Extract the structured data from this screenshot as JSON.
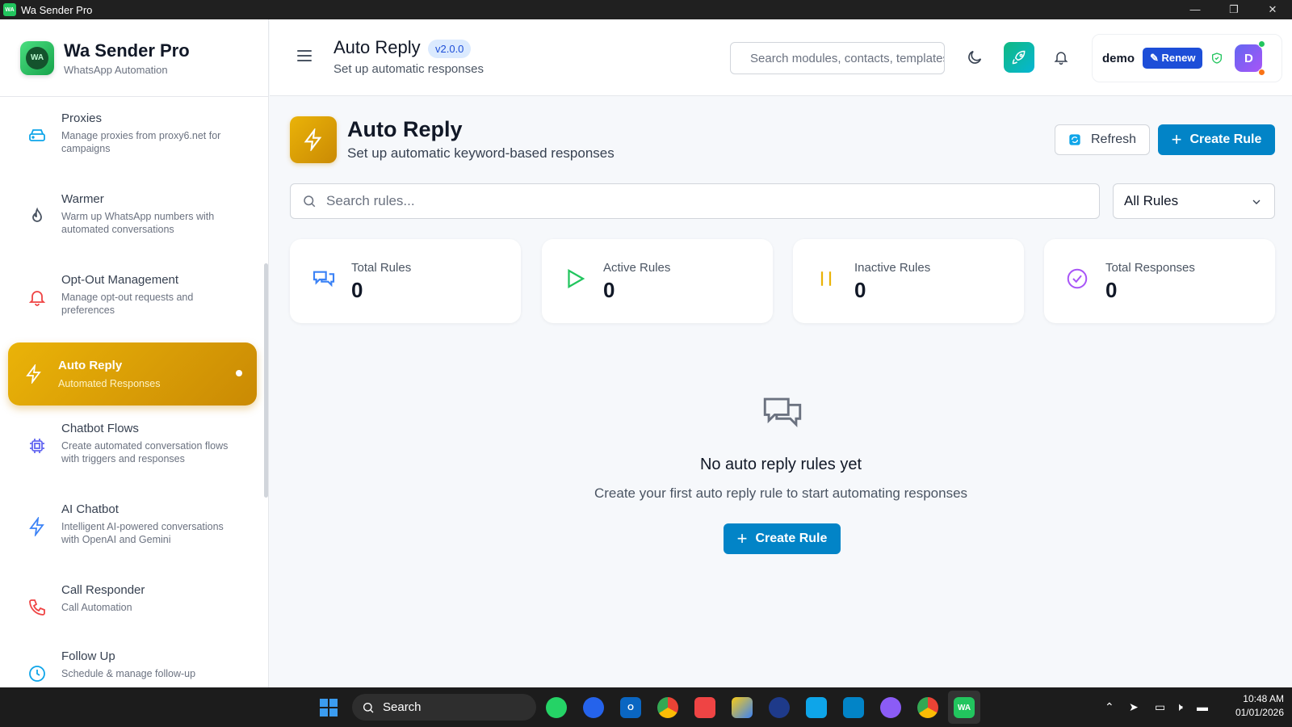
{
  "window": {
    "title": "Wa Sender Pro",
    "controls": [
      "—",
      "❐",
      "✕"
    ]
  },
  "brand": {
    "name": "Wa Sender Pro",
    "subtitle": "WhatsApp Automation",
    "logo_text": "WA"
  },
  "sidebar": {
    "items": [
      {
        "label": "Proxies",
        "desc": "Manage proxies from proxy6.net for campaigns",
        "icon": "server-icon",
        "color": "#0ea5e9"
      },
      {
        "label": "Warmer",
        "desc": "Warm up WhatsApp numbers with automated conversations",
        "icon": "flame-icon",
        "color": "#4b5563"
      },
      {
        "label": "Opt-Out Management",
        "desc": "Manage opt-out requests and preferences",
        "icon": "bell-off-icon",
        "color": "#ef4444"
      },
      {
        "label": "Auto Reply",
        "desc": "Automated Responses",
        "icon": "lightning-icon",
        "active": true
      },
      {
        "label": "Chatbot Flows",
        "desc": "Create automated conversation flows with triggers and responses",
        "icon": "cpu-icon",
        "color": "#6366f1"
      },
      {
        "label": "AI Chatbot",
        "desc": "Intelligent AI-powered conversations with OpenAI and Gemini",
        "icon": "lightning-icon",
        "color": "#3b82f6"
      },
      {
        "label": "Call Responder",
        "desc": "Call Automation",
        "icon": "phone-icon",
        "color": "#ef4444"
      },
      {
        "label": "Follow Up",
        "desc": "Schedule & manage follow-up",
        "icon": "clock-icon",
        "color": "#0ea5e9"
      }
    ]
  },
  "header": {
    "title": "Auto Reply",
    "version": "v2.0.0",
    "subtitle": "Set up automatic responses",
    "search_placeholder": "Search modules, contacts, templates...",
    "user": "demo",
    "renew_label": "Renew",
    "avatar_initial": "D"
  },
  "page": {
    "title": "Auto Reply",
    "subtitle": "Set up automatic keyword-based responses",
    "refresh_label": "Refresh",
    "create_label": "Create Rule",
    "search_placeholder": "Search rules...",
    "filter_value": "All Rules"
  },
  "stats": [
    {
      "label": "Total Rules",
      "value": "0",
      "icon": "chat-bubbles-icon",
      "color": "#3b82f6"
    },
    {
      "label": "Active Rules",
      "value": "0",
      "icon": "play-icon",
      "color": "#22c55e"
    },
    {
      "label": "Inactive Rules",
      "value": "0",
      "icon": "pause-icon",
      "color": "#eab308"
    },
    {
      "label": "Total Responses",
      "value": "0",
      "icon": "check-circle-icon",
      "color": "#a855f7"
    }
  ],
  "empty_state": {
    "title": "No auto reply rules yet",
    "description": "Create your first auto reply rule to start automating responses",
    "button_label": "Create Rule"
  },
  "taskbar": {
    "search_label": "Search",
    "time": "10:48 AM",
    "date": "01/01/2026"
  }
}
